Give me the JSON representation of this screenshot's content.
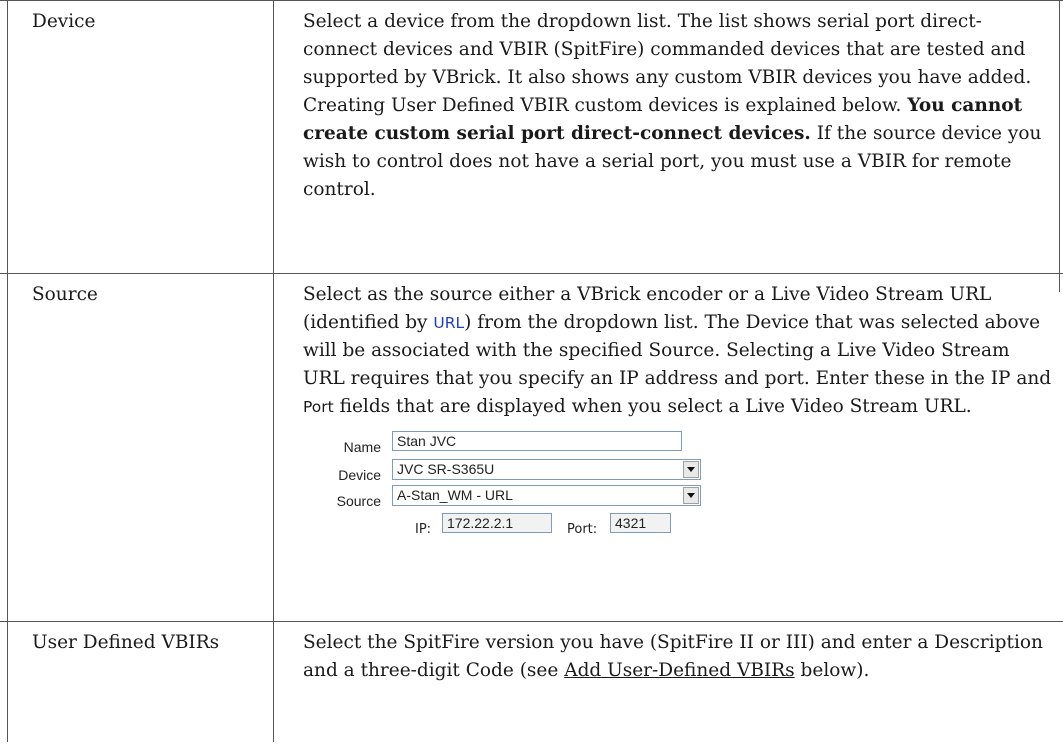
{
  "rows": [
    {
      "label": "Device",
      "text": [
        "Select a device from the dropdown list. The list shows serial port direct-connect devices and VBIR (SpitFire) commanded devices that are tested and supported by VBrick. It also shows any custom VBIR devices you have added. Creating User Defined VBIR custom devices is explained below. ",
        "You cannot create custom serial port direct-connect devices.",
        " If the source device you wish to control does not have a serial port, you must use a VBIR for remote control."
      ]
    },
    {
      "label": "Source",
      "text": [
        "Select as the source either a VBrick encoder or a Live Video Stream URL (identified by ",
        "URL",
        ") from the dropdown list. The Device that was selected above will be associated with the specified Source. Selecting a Live Video Stream URL requires that you specify an IP address and port. Enter these in the IP and ",
        "Port",
        " fields that are displayed when you select a Live Video Stream URL."
      ],
      "form": {
        "name_label": "Name",
        "name_value": "Stan JVC",
        "device_label": "Device",
        "device_value": "JVC SR-S365U",
        "source_label": "Source",
        "source_value": "A-Stan_WM - URL",
        "ip_label": "IP:",
        "ip_value": "172.22.2.1",
        "port_label": "Port:",
        "port_value": "4321"
      }
    },
    {
      "label": "User Defined VBIRs",
      "text": [
        "Select the SpitFire version you have (SpitFire II or III) and enter a Description and a three-digit Code (see ",
        "Add User-Defined VBIRs",
        " below)."
      ]
    }
  ]
}
